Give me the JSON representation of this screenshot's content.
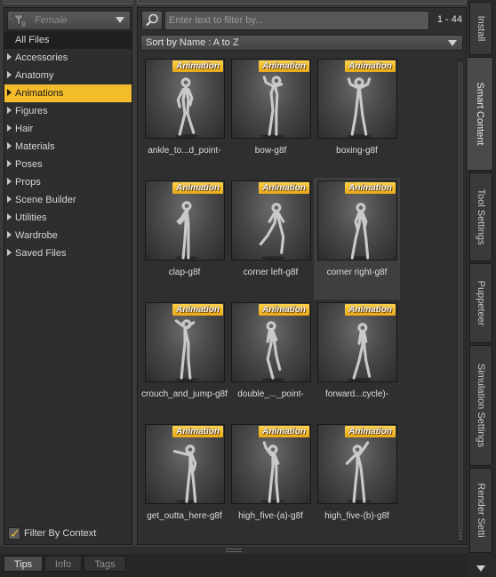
{
  "filter": {
    "placeholder": "Female"
  },
  "categories": [
    {
      "label": "All Files",
      "arrow": false
    },
    {
      "label": "Accessories",
      "arrow": true
    },
    {
      "label": "Anatomy",
      "arrow": true
    },
    {
      "label": "Animations",
      "arrow": true,
      "selected": true
    },
    {
      "label": "Figures",
      "arrow": true
    },
    {
      "label": "Hair",
      "arrow": true
    },
    {
      "label": "Materials",
      "arrow": true
    },
    {
      "label": "Poses",
      "arrow": true
    },
    {
      "label": "Props",
      "arrow": true
    },
    {
      "label": "Scene Builder",
      "arrow": true
    },
    {
      "label": "Utilities",
      "arrow": true
    },
    {
      "label": "Wardrobe",
      "arrow": true
    },
    {
      "label": "Saved Files",
      "arrow": true
    }
  ],
  "filter_by_context": {
    "label": "Filter By Context",
    "checked": true
  },
  "search": {
    "placeholder": "Enter text to filter by...",
    "count": "1 - 44"
  },
  "sort": {
    "label": "Sort by Name : A to Z"
  },
  "badge_text": "Animation",
  "accent_color": "#f2bc2a",
  "tiles": [
    {
      "label": "ankle_to...d_point-"
    },
    {
      "label": "bow-g8f"
    },
    {
      "label": "boxing-g8f"
    },
    {
      "label": "clap-g8f"
    },
    {
      "label": "corner left-g8f"
    },
    {
      "label": "corner right-g8f",
      "hover": true
    },
    {
      "label": "crouch_and_jump-g8f"
    },
    {
      "label": "double_..._point-"
    },
    {
      "label": "forward...cycle)-"
    },
    {
      "label": "get_outta_here-g8f"
    },
    {
      "label": "high_five-(a)-g8f"
    },
    {
      "label": "high_five-(b)-g8f"
    }
  ],
  "side_tabs": [
    {
      "label": "Install"
    },
    {
      "label": "Smart Content",
      "active": true
    },
    {
      "label": "Tool Settings"
    },
    {
      "label": "Puppeteer"
    },
    {
      "label": "Simulation Settings"
    },
    {
      "label": "Render Setti"
    }
  ],
  "bottom_tabs": [
    {
      "label": "Tips",
      "active": true
    },
    {
      "label": "Info"
    },
    {
      "label": "Tags"
    }
  ]
}
